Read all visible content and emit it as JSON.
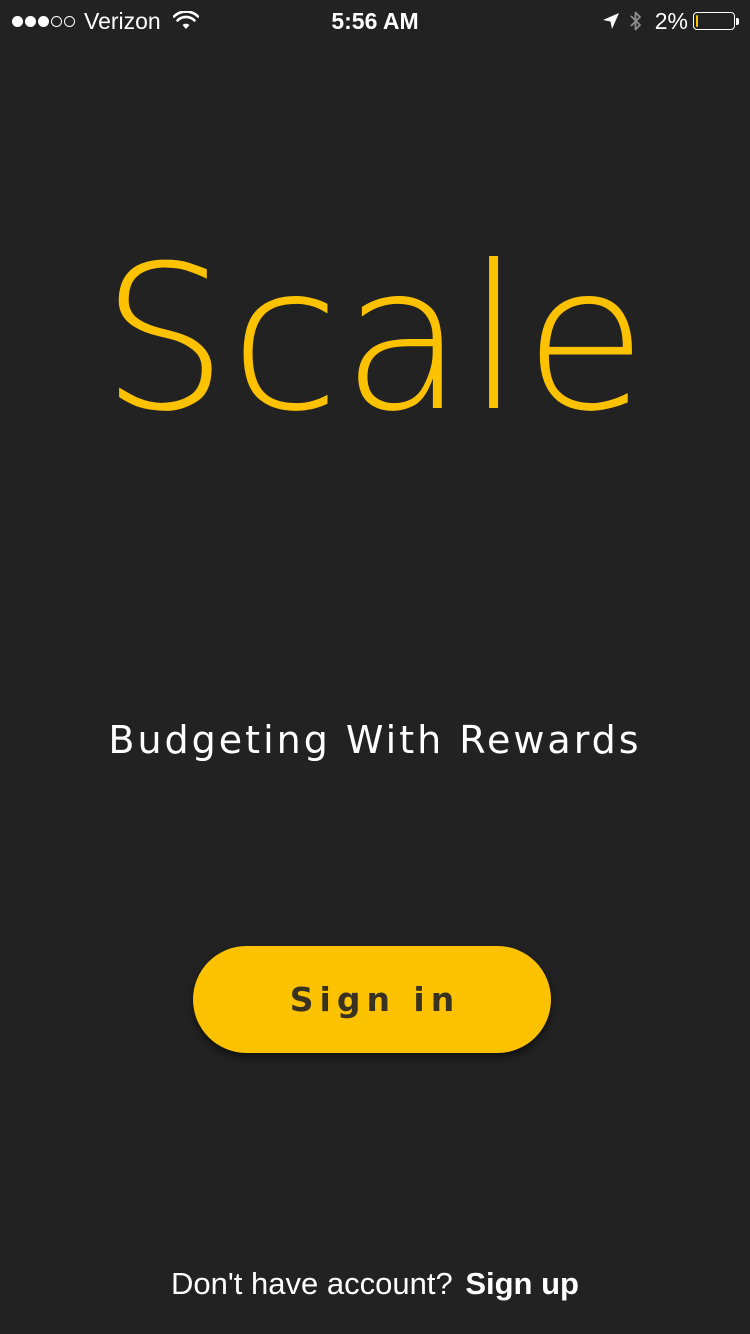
{
  "status_bar": {
    "signal_bars_filled": 3,
    "signal_bars_total": 5,
    "carrier": "Verizon",
    "wifi_icon": "wifi-icon",
    "time": "5:56 AM",
    "location_icon": "location-arrow-icon",
    "bluetooth_icon": "bluetooth-icon",
    "battery_percent_text": "2%",
    "battery_level": 0.02,
    "battery_fill_color": "#fcc200"
  },
  "main": {
    "title": "Scale",
    "tagline": "Budgeting With Rewards",
    "sign_in_label": "Sign in"
  },
  "footer": {
    "prompt": "Don't have account?",
    "signup_label": "Sign up"
  },
  "colors": {
    "background": "#222222",
    "accent": "#fcc200",
    "text": "#ffffff",
    "button_text": "#3a3220"
  }
}
